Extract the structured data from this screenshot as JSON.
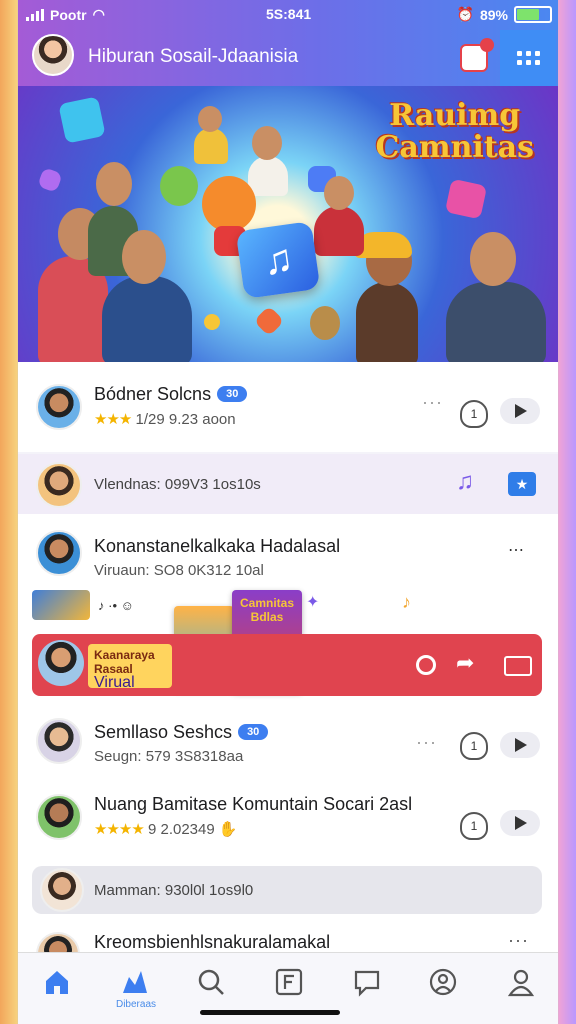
{
  "status_bar": {
    "carrier": "Pootr",
    "time": "5S:841",
    "battery": "89%"
  },
  "header": {
    "title": "Hiburan Sosail-Jdaanisia"
  },
  "banner": {
    "headline_line1": "Rauimg",
    "headline_line2": "Camnitas"
  },
  "feed": [
    {
      "name": "Bódner Solcns",
      "badge": "30",
      "meta": "1/29 9.23 aoon",
      "num": "1"
    },
    {
      "name": "",
      "meta": "Vlendnas: 099V3 1os10s"
    },
    {
      "name": "Konanstanelkalkaka Hadalasal",
      "meta": "Viruaun: SO8 0K312 10al"
    },
    {
      "name": "Semllaso Seshcs",
      "badge": "30",
      "meta": "Seugn: 579 3S8318aa",
      "num": "1"
    },
    {
      "name": "Nuang Bamitase Komuntain Socari 2asl",
      "meta": "9 2.02349",
      "num": "1"
    },
    {
      "name": "",
      "meta": "Mamman: 930l0l 1os9l0"
    },
    {
      "name": "Kreomsbienhlsnakuralamakal",
      "meta": ""
    }
  ],
  "promo": {
    "label_title": "Kaanaraya Rasaal",
    "label_sub": "Virual"
  },
  "books": [
    {
      "title": "Camnitas Bdlas"
    }
  ],
  "tabs": [
    "home",
    "explore",
    "search",
    "post",
    "messages",
    "profile-circle",
    "profile"
  ],
  "tab_explore_label": "Diberaas",
  "colors": {
    "accent": "#3d7ef0",
    "promo": "#e0444f",
    "header_start": "#a45bd6",
    "header_end": "#4a88f0"
  }
}
